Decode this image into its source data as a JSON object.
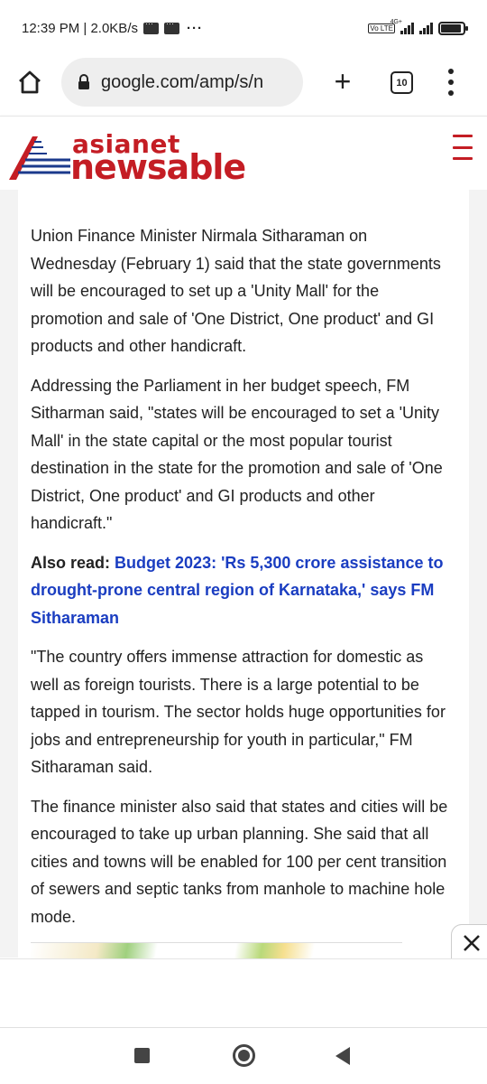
{
  "status_bar": {
    "time": "12:39 PM",
    "data_rate": "2.0KB/s",
    "network_type": "4G+",
    "volte": "Vo LTE"
  },
  "browser": {
    "url": "google.com/amp/s/n",
    "tab_count": "10"
  },
  "site": {
    "logo_top": "asianet",
    "logo_bottom": "newsable",
    "brand_color": "#c41d24"
  },
  "article": {
    "paragraphs": [
      "Union Finance Minister Nirmala Sitharaman on Wednesday (February 1) said that the state governments will be encouraged to set up a 'Unity Mall' for the promotion and sale of 'One District, One product' and GI products and other handicraft.",
      "Addressing the Parliament in her budget speech, FM Sitharman said, \"states will be encouraged to set a 'Unity Mall' in the state capital or the most popular tourist destination in the state for the promotion and sale of 'One District, One product' and GI products and other handicraft.\"",
      "\"The country offers immense attraction for domestic as well as foreign tourists. There is a large potential to be tapped in tourism. The sector holds huge opportunities for jobs and entrepreneurship for youth in particular,\" FM Sitharaman said.",
      "The finance minister also said that states and cities will be encouraged to take up urban planning. She said that all cities and towns will be enabled for 100 per cent transition of sewers and septic tanks from manhole to machine hole mode."
    ],
    "also_read_label": "Also read:",
    "also_read_link": "Budget 2023: 'Rs 5,300 crore assistance to drought-prone central region of Karnataka,' says FM Sitharaman",
    "link_color": "#1a3dc1"
  }
}
